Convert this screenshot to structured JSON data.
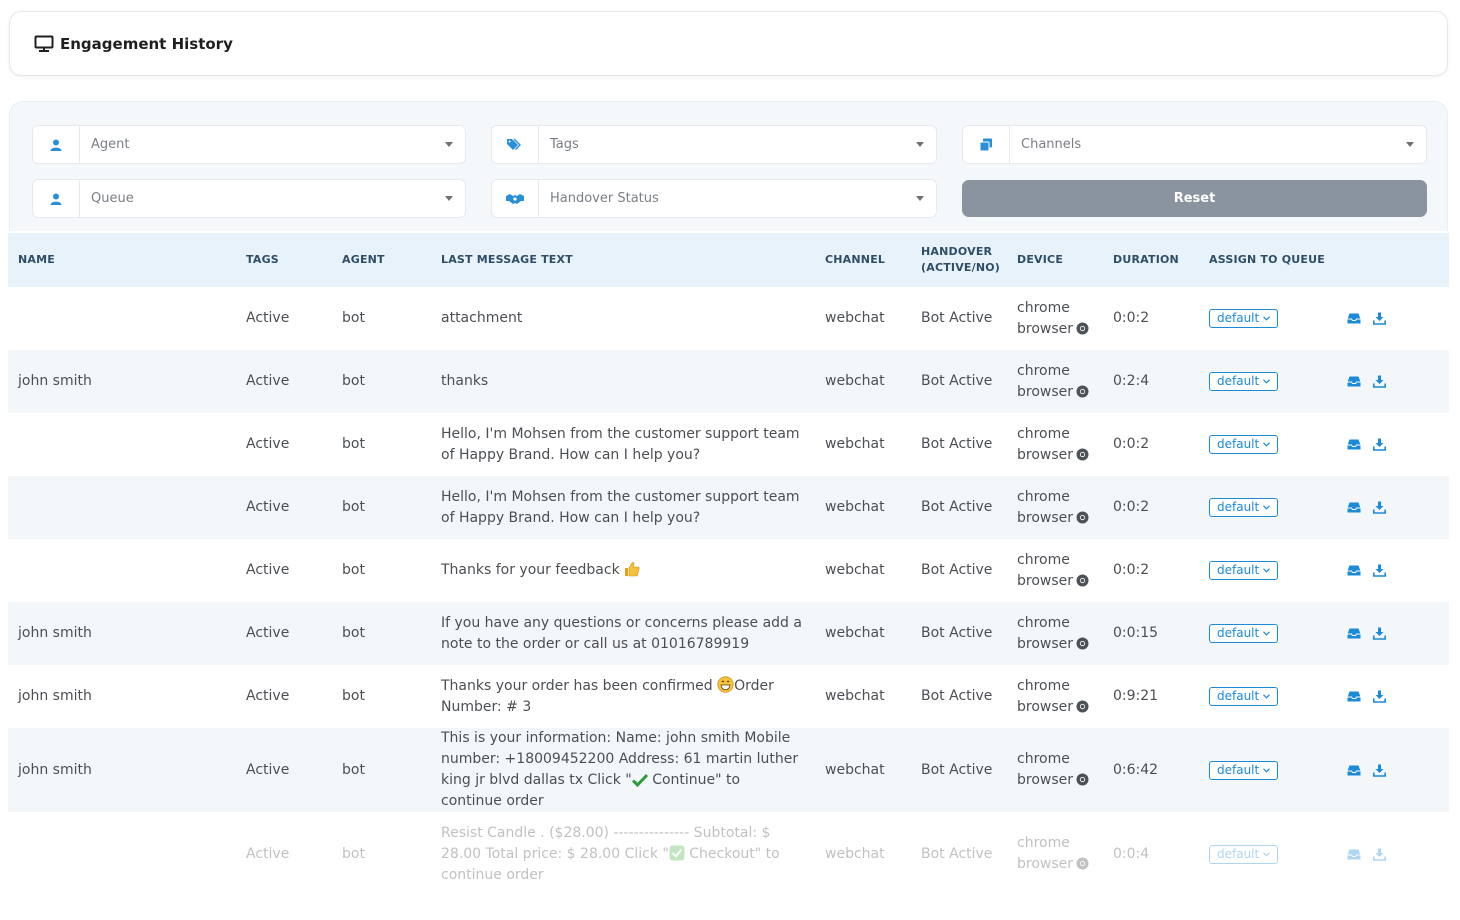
{
  "header": {
    "title": "Engagement History",
    "icon": "monitor-icon"
  },
  "filters": {
    "agent": {
      "label": "Agent",
      "icon": "user-icon"
    },
    "tags": {
      "label": "Tags",
      "icon": "tag-icon"
    },
    "channels": {
      "label": "Channels",
      "icon": "channels-icon"
    },
    "queue": {
      "label": "Queue",
      "icon": "user-icon"
    },
    "handover": {
      "label": "Handover Status",
      "icon": "handshake-icon"
    },
    "reset_label": "Reset"
  },
  "table": {
    "columns": {
      "name": "NAME",
      "tags": "TAGS",
      "agent": "AGENT",
      "last_message": "LAST MESSAGE TEXT",
      "channel": "CHANNEL",
      "handover": "HANDOVER (ACTIVE/NO)",
      "device": "DEVICE",
      "duration": "DURATION",
      "assign_queue": "ASSIGN TO QUEUE"
    },
    "rows": [
      {
        "name": "",
        "tags": "Active",
        "agent": "bot",
        "message": "attachment",
        "emoji": "",
        "message_after": "",
        "channel": "webchat",
        "handover": "Bot Active",
        "device_1": "chrome",
        "device_2": "browser",
        "duration": "0:0:2",
        "queue": "default"
      },
      {
        "name": "john smith",
        "tags": "Active",
        "agent": "bot",
        "message": "thanks",
        "emoji": "",
        "message_after": "",
        "channel": "webchat",
        "handover": "Bot Active",
        "device_1": "chrome",
        "device_2": "browser",
        "duration": "0:2:4",
        "queue": "default"
      },
      {
        "name": "",
        "tags": "Active",
        "agent": "bot",
        "message": "Hello, I'm Mohsen from the customer support team of Happy Brand. How can I help you?",
        "emoji": "",
        "message_after": "",
        "channel": "webchat",
        "handover": "Bot Active",
        "device_1": "chrome",
        "device_2": "browser",
        "duration": "0:0:2",
        "queue": "default"
      },
      {
        "name": "",
        "tags": "Active",
        "agent": "bot",
        "message": "Hello, I'm Mohsen from the customer support team of Happy Brand. How can I help you?",
        "emoji": "",
        "message_after": "",
        "channel": "webchat",
        "handover": "Bot Active",
        "device_1": "chrome",
        "device_2": "browser",
        "duration": "0:0:2",
        "queue": "default"
      },
      {
        "name": "",
        "tags": "Active",
        "agent": "bot",
        "message": "Thanks for your feedback ",
        "emoji": "thumbs-up-emoji",
        "message_after": "",
        "channel": "webchat",
        "handover": "Bot Active",
        "device_1": "chrome",
        "device_2": "browser",
        "duration": "0:0:2",
        "queue": "default"
      },
      {
        "name": "john smith",
        "tags": "Active",
        "agent": "bot",
        "message": "If you have any questions or concerns please add a note to the order or call us at 01016789919",
        "emoji": "",
        "message_after": "",
        "channel": "webchat",
        "handover": "Bot Active",
        "device_1": "chrome",
        "device_2": "browser",
        "duration": "0:0:15",
        "queue": "default"
      },
      {
        "name": "john smith",
        "tags": "Active",
        "agent": "bot",
        "message": "Thanks your order has been confirmed ",
        "emoji": "grin-emoji",
        "message_after": "Order Number: # 3",
        "channel": "webchat",
        "handover": "Bot Active",
        "device_1": "chrome",
        "device_2": "browser",
        "duration": "0:9:21",
        "queue": "default"
      },
      {
        "name": "john smith",
        "tags": "Active",
        "agent": "bot",
        "message": "This is your information: Name: john smith Mobile number: +18009452200 Address: 61 martin luther king jr blvd dallas tx Click \"",
        "emoji": "check-mark-emoji",
        "message_after": " Continue\" to continue order",
        "channel": "webchat",
        "handover": "Bot Active",
        "device_1": "chrome",
        "device_2": "browser",
        "duration": "0:6:42",
        "queue": "default"
      },
      {
        "name": "",
        "tags": "Active",
        "agent": "bot",
        "message": "Resist Candle . ($28.00) --------------- Subtotal: $ 28.00 Total price: $ 28.00 Click \"",
        "emoji": "check-box-emoji",
        "message_after": " Checkout\" to continue order",
        "channel": "webchat",
        "handover": "Bot Active",
        "device_1": "chrome",
        "device_2": "browser",
        "duration": "0:0:4",
        "queue": "default"
      }
    ]
  },
  "colors": {
    "accent": "#1b8ad8",
    "header_bg": "#e7f2fb",
    "reset_bg": "#8a949e"
  }
}
